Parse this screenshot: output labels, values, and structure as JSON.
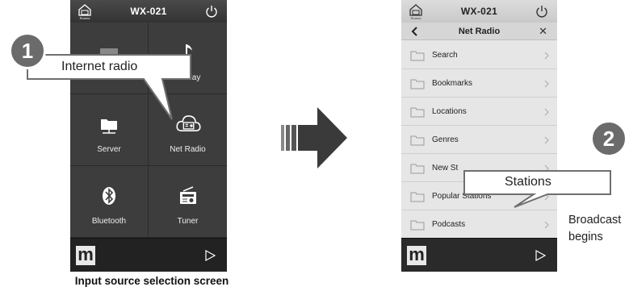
{
  "left_screen": {
    "device_name": "WX-021",
    "home_label": "Rooms",
    "sources": [
      {
        "label": "",
        "icon": "hidden-tile-icon"
      },
      {
        "label": "AirPlay",
        "icon": "music-note-icon"
      },
      {
        "label": "Server",
        "icon": "folder-server-icon"
      },
      {
        "label": "Net Radio",
        "icon": "cloud-radio-icon"
      },
      {
        "label": "Bluetooth",
        "icon": "bluetooth-icon"
      },
      {
        "label": "Tuner",
        "icon": "radio-tuner-icon"
      }
    ],
    "player_logo": "m",
    "caption": "Input source selection screen"
  },
  "callout_1": {
    "number": "1",
    "text": "Internet radio"
  },
  "right_screen": {
    "device_name": "WX-021",
    "home_label": "Rooms",
    "nav_title": "Net Radio",
    "close_label": "✕",
    "items": [
      {
        "label": "Search"
      },
      {
        "label": "Bookmarks"
      },
      {
        "label": "Locations"
      },
      {
        "label": "Genres"
      },
      {
        "label": "New St"
      },
      {
        "label": "Popular Stations"
      },
      {
        "label": "Podcasts"
      }
    ],
    "player_logo": "m"
  },
  "callout_2": {
    "number": "2",
    "text": "Stations"
  },
  "side_note": {
    "line1": "Broadcast",
    "line2": "begins"
  },
  "colors": {
    "badge": "#6b6b6b",
    "dark_tile": "#3d3d3d",
    "list_bg": "#e6e6e6",
    "arrow": "#3a3a3a"
  }
}
